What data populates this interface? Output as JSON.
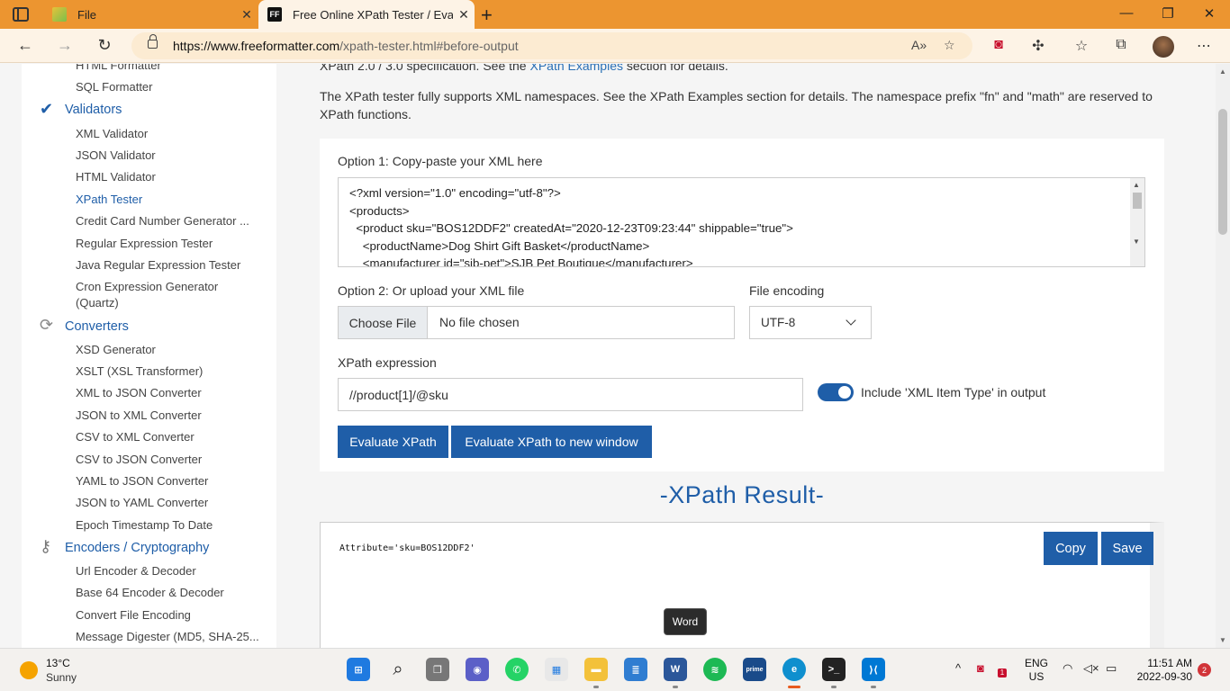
{
  "browser": {
    "tabs": [
      {
        "title": "File",
        "active": false
      },
      {
        "title": "Free Online XPath Tester / Evalu",
        "favicon": "FF",
        "active": true
      }
    ],
    "url_domain": "https://www.freeformatter.com",
    "url_path": "/xpath-tester.html#before-output"
  },
  "sidebar": {
    "items_top": [
      "HTML Formatter",
      "SQL Formatter"
    ],
    "validators": {
      "heading": "Validators",
      "items": [
        "XML Validator",
        "JSON Validator",
        "HTML Validator",
        "XPath Tester",
        "Credit Card Number Generator ...",
        "Regular Expression Tester",
        "Java Regular Expression Tester",
        "Cron Expression Generator",
        "(Quartz)"
      ]
    },
    "converters": {
      "heading": "Converters",
      "items": [
        "XSD Generator",
        "XSLT (XSL Transformer)",
        "XML to JSON Converter",
        "JSON to XML Converter",
        "CSV to XML Converter",
        "CSV to JSON Converter",
        "YAML to JSON Converter",
        "JSON to YAML Converter",
        "Epoch Timestamp To Date"
      ]
    },
    "encoders": {
      "heading": "Encoders / Cryptography",
      "items": [
        "Url Encoder & Decoder",
        "Base 64 Encoder & Decoder",
        "Convert File Encoding",
        "Message Digester (MD5, SHA-25..."
      ]
    }
  },
  "main": {
    "intro_line1_a": "XPath 2.0 / 3.0 specification. See the ",
    "intro_line1_link": "XPath Examples",
    "intro_line1_b": " section for details.",
    "intro_para2": "The XPath tester fully supports XML namespaces. See the XPath Examples section for details. The namespace prefix \"fn\" and \"math\" are reserved to XPath functions.",
    "option1_label": "Option 1: Copy-paste your XML here",
    "xml_lines": [
      "<?xml version=\"1.0\" encoding=\"utf-8\"?>",
      "<products>",
      "  <product sku=\"BOS12DDF2\" createdAt=\"2020-12-23T09:23:44\" shippable=\"true\">",
      "    <productName>Dog Shirt Gift Basket</productName>",
      "    <manufacturer id=\"sib-pet\">SJB Pet Boutique</manufacturer>"
    ],
    "option2_label": "Option 2: Or upload your XML file",
    "choose_file": "Choose File",
    "no_file": "No file chosen",
    "file_encoding_label": "File encoding",
    "file_encoding_value": "UTF-8",
    "xpath_label": "XPath expression",
    "xpath_value": "//product[1]/@sku",
    "toggle_label": "Include 'XML Item Type' in output",
    "toggle_on": true,
    "evaluate_button": "Evaluate XPath",
    "evaluate_new_window_button": "Evaluate XPath to new window",
    "result_title": "-XPath Result-",
    "result_text": "Attribute='sku=BOS12DDF2'",
    "copy_button": "Copy",
    "save_button": "Save",
    "tooltip": "Word"
  },
  "taskbar": {
    "temperature": "13°C",
    "condition": "Sunny",
    "lang_1": "ENG",
    "lang_2": "US",
    "time": "11:51 AM",
    "date": "2022-09-30",
    "notifications": "2",
    "mcafee_badge": "1"
  },
  "colors": {
    "tabbar": "#ec9530",
    "accent": "#1f5ea8",
    "page_bg": "#f5f5f5"
  }
}
